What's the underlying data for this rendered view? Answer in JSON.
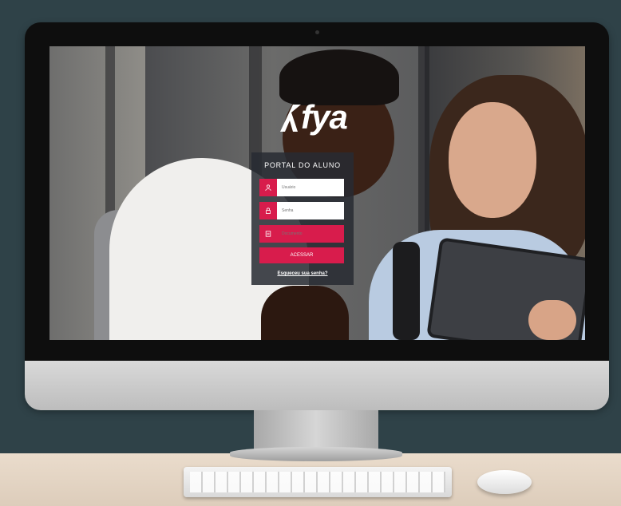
{
  "brand": {
    "logo_text": "fya",
    "accent": "#d81c4c"
  },
  "login": {
    "title": "PORTAL DO ALUNO",
    "username_placeholder": "Usuário",
    "password_placeholder": "Senha",
    "code_placeholder": "Documento",
    "submit_label": "ACESSAR",
    "forgot_label": "Esqueceu sua senha?"
  },
  "icons": {
    "username": "user-icon",
    "password": "lock-icon",
    "code": "id-card-icon"
  }
}
